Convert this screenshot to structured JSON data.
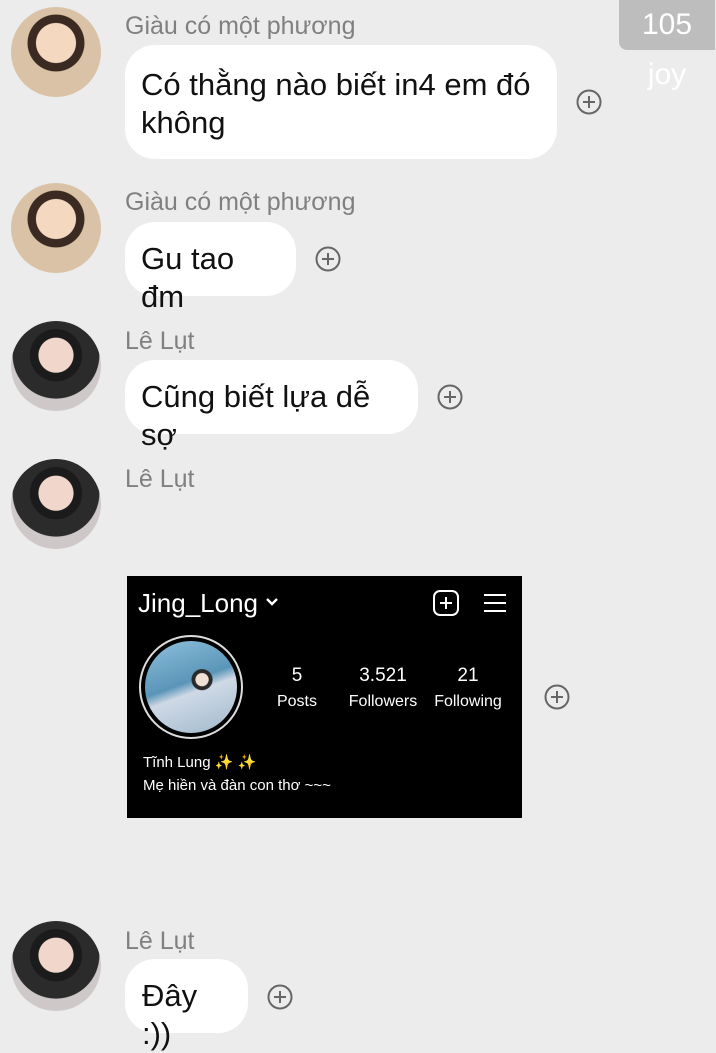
{
  "counter": "105 joy",
  "messages": [
    {
      "sender": "Giàu có một phương",
      "text": "Có thằng nào biết in4 em đó không"
    },
    {
      "sender": "Giàu có một phương",
      "text": "Gu tao đm"
    },
    {
      "sender": "Lê Lụt",
      "text": "Cũng biết lựa dễ sợ"
    },
    {
      "sender": "Lê Lụt",
      "text": ""
    },
    {
      "sender": "Lê Lụt",
      "text": "Đây :))"
    }
  ],
  "profile_card": {
    "username": "Jing_Long",
    "stats": [
      {
        "value": "5",
        "label": "Posts"
      },
      {
        "value": "3.521",
        "label": "Followers"
      },
      {
        "value": "21",
        "label": "Following"
      }
    ],
    "bio_name": "Tĩnh Lung ✨ ✨",
    "bio_text": "Mẹ hiền và đàn con thơ ~~~"
  },
  "colors": {
    "background": "#ececec",
    "bubble": "#ffffff",
    "name": "#808080",
    "card": "#000000"
  },
  "icons": {
    "react": "add-reaction-icon",
    "dropdown": "chevron-down-icon",
    "new_post": "add-square-icon",
    "menu": "hamburger-menu-icon"
  }
}
